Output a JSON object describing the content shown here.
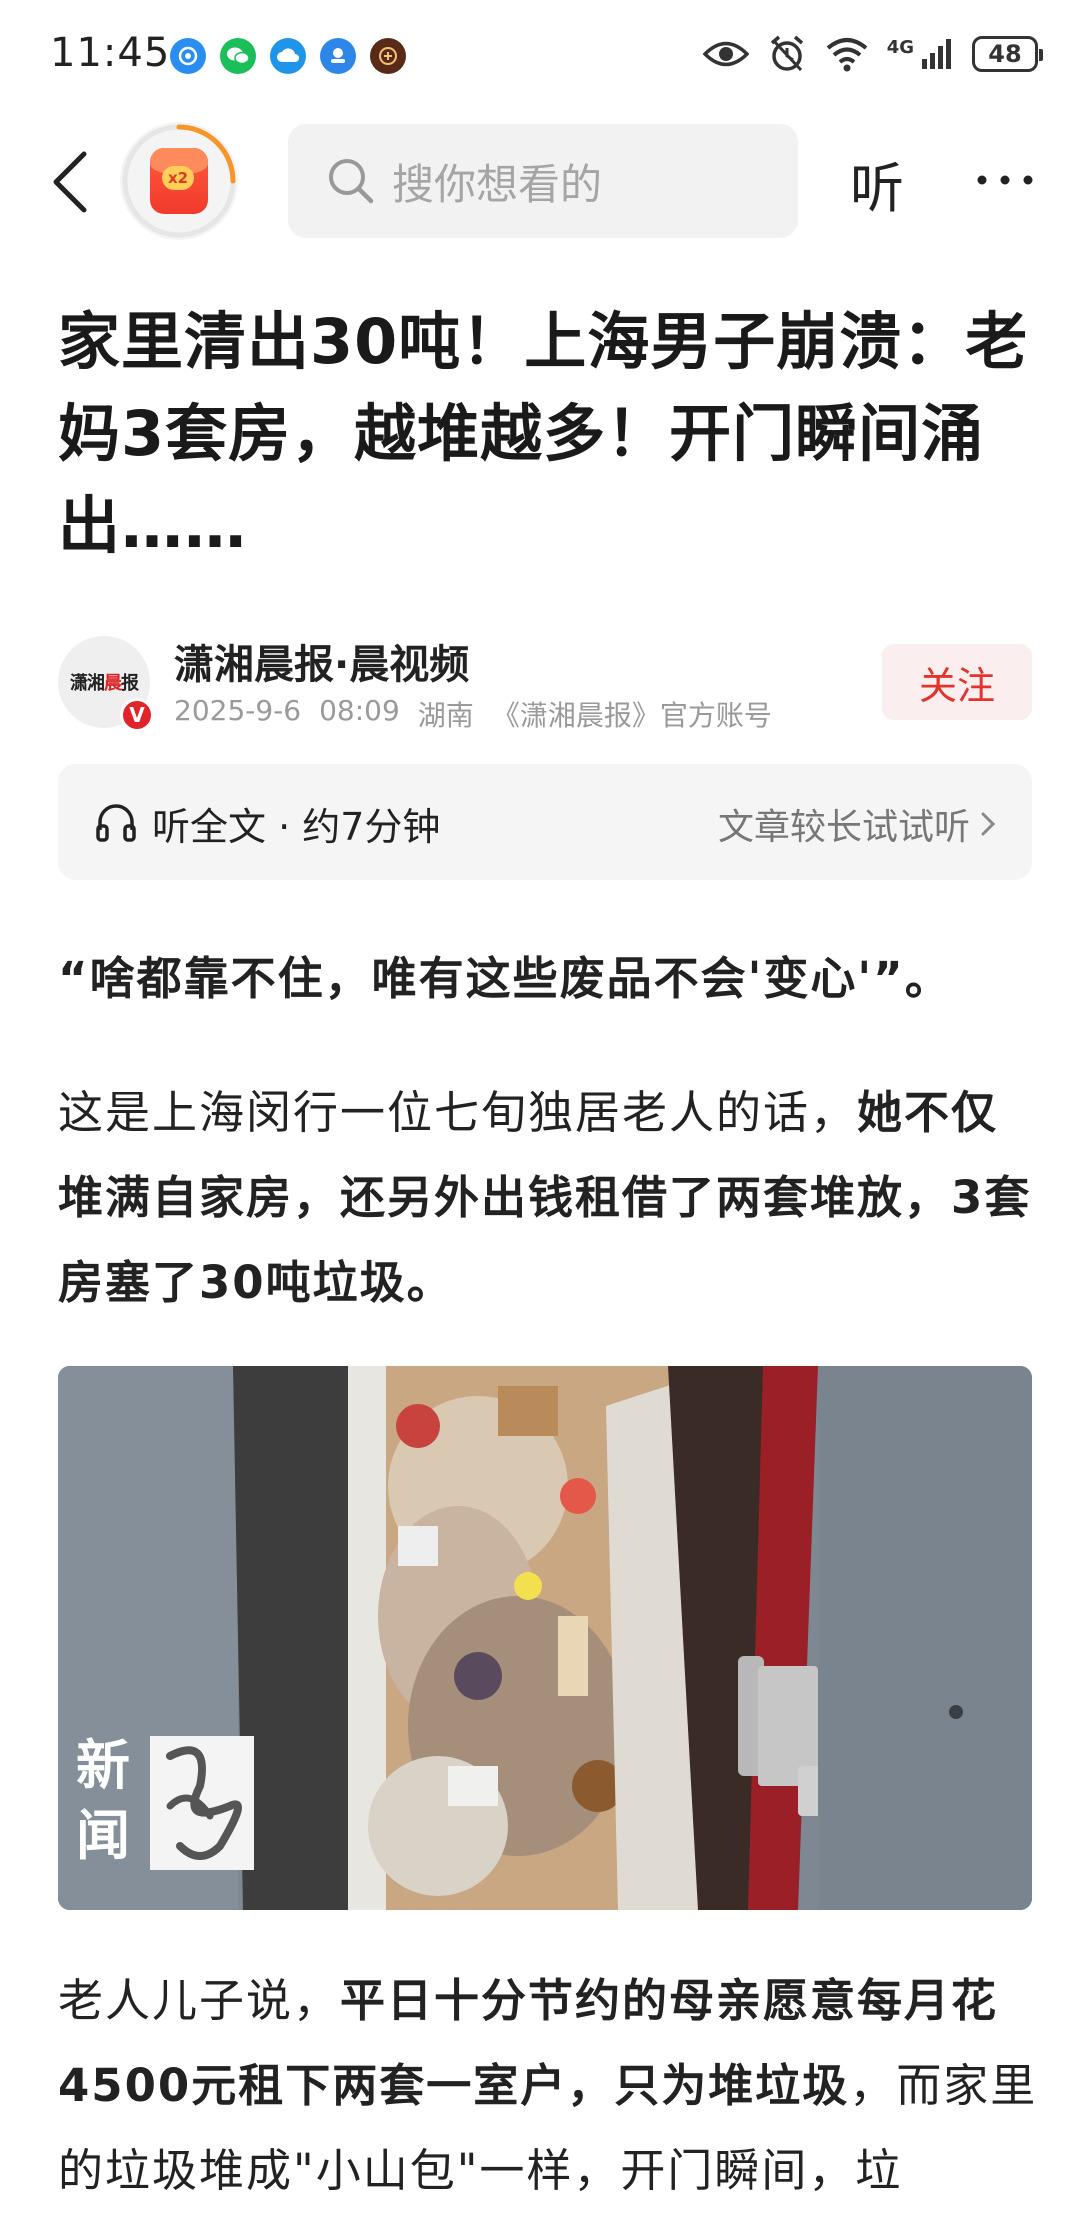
{
  "status_bar": {
    "time": "11:45",
    "network": "4G",
    "battery": "48",
    "app_icons": [
      {
        "name": "browser-app-icon",
        "color": "#2a8ef0"
      },
      {
        "name": "wechat-app-icon",
        "color": "#1bbf5a"
      },
      {
        "name": "cloud-app-icon",
        "color": "#1f95ea"
      },
      {
        "name": "assistant-app-icon",
        "color": "#2d86e8"
      },
      {
        "name": "game-app-icon",
        "color": "#5a2a18"
      }
    ]
  },
  "nav": {
    "search_placeholder": "搜你想看的",
    "listen_label": "听",
    "redpacket_badge": "x2"
  },
  "article": {
    "title": "家里清出30吨！上海男子崩溃：老妈3套房，越堆越多！开门瞬间涌出……",
    "author": {
      "name": "潇湘晨报·晨视频",
      "avatar_text_part1": "潇湘",
      "avatar_text_part2": "晨",
      "avatar_text_part3": "报",
      "verified_mark": "V",
      "date": "2025-9-6",
      "time": "08:09",
      "location": "湖南",
      "account_desc": "《潇湘晨报》官方账号",
      "follow_label": "关注"
    },
    "listen_bar": {
      "left_label": "听全文 · 约7分钟",
      "right_label": "文章较长试试听"
    },
    "quote": "“啥都靠不住，唯有这些废品不会'变心'”。",
    "p1_normal": "这是上海闵行一位七旬独居老人的话，",
    "p1_bold": "她不仅堆满自家房，还另外出钱租借了两套堆放，3套房塞了30吨垃圾。",
    "image_watermark_line1": "新",
    "image_watermark_line2": "闻",
    "p2_normal": "老人儿子说，",
    "p2_bold": "平日十分节约的母亲愿意每月花4500元租下两套一室户，只为堆垃圾",
    "p2_tail": "，而家里的垃圾堆成\"小山包\"一样，开门瞬间，垃"
  }
}
